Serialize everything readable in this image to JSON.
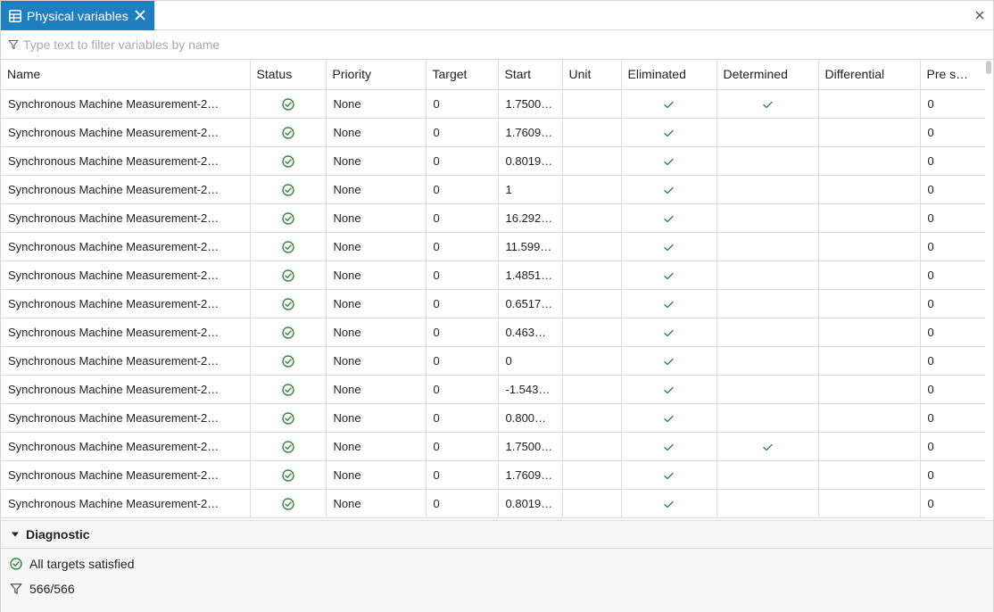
{
  "tab": {
    "label": "Physical variables",
    "icon": "table-icon"
  },
  "filter": {
    "placeholder": "Type text to filter variables by name",
    "value": ""
  },
  "columns": [
    "Name",
    "Status",
    "Priority",
    "Target",
    "Start",
    "Unit",
    "Eliminated",
    "Determined",
    "Differential",
    "Pre s…"
  ],
  "rows": [
    {
      "name": "Synchronous Machine Measurement-2…",
      "status": "ok",
      "priority": "None",
      "target": "0",
      "start": "1.7500…",
      "unit": "",
      "eliminated": true,
      "determined": true,
      "differential": false,
      "pre": "0"
    },
    {
      "name": "Synchronous Machine Measurement-2…",
      "status": "ok",
      "priority": "None",
      "target": "0",
      "start": "1.7609…",
      "unit": "",
      "eliminated": true,
      "determined": false,
      "differential": false,
      "pre": "0"
    },
    {
      "name": "Synchronous Machine Measurement-2…",
      "status": "ok",
      "priority": "None",
      "target": "0",
      "start": "0.8019…",
      "unit": "",
      "eliminated": true,
      "determined": false,
      "differential": false,
      "pre": "0"
    },
    {
      "name": "Synchronous Machine Measurement-2…",
      "status": "ok",
      "priority": "None",
      "target": "0",
      "start": "1",
      "unit": "",
      "eliminated": true,
      "determined": false,
      "differential": false,
      "pre": "0"
    },
    {
      "name": "Synchronous Machine Measurement-2…",
      "status": "ok",
      "priority": "None",
      "target": "0",
      "start": "16.292…",
      "unit": "",
      "eliminated": true,
      "determined": false,
      "differential": false,
      "pre": "0"
    },
    {
      "name": "Synchronous Machine Measurement-2…",
      "status": "ok",
      "priority": "None",
      "target": "0",
      "start": "11.599…",
      "unit": "",
      "eliminated": true,
      "determined": false,
      "differential": false,
      "pre": "0"
    },
    {
      "name": "Synchronous Machine Measurement-2…",
      "status": "ok",
      "priority": "None",
      "target": "0",
      "start": "1.4851…",
      "unit": "",
      "eliminated": true,
      "determined": false,
      "differential": false,
      "pre": "0"
    },
    {
      "name": "Synchronous Machine Measurement-2…",
      "status": "ok",
      "priority": "None",
      "target": "0",
      "start": "0.6517…",
      "unit": "",
      "eliminated": true,
      "determined": false,
      "differential": false,
      "pre": "0"
    },
    {
      "name": "Synchronous Machine Measurement-2…",
      "status": "ok",
      "priority": "None",
      "target": "0",
      "start": "0.463…",
      "unit": "",
      "eliminated": true,
      "determined": false,
      "differential": false,
      "pre": "0"
    },
    {
      "name": "Synchronous Machine Measurement-2…",
      "status": "ok",
      "priority": "None",
      "target": "0",
      "start": "0",
      "unit": "",
      "eliminated": true,
      "determined": false,
      "differential": false,
      "pre": "0"
    },
    {
      "name": "Synchronous Machine Measurement-2…",
      "status": "ok",
      "priority": "None",
      "target": "0",
      "start": "-1.543…",
      "unit": "",
      "eliminated": true,
      "determined": false,
      "differential": false,
      "pre": "0"
    },
    {
      "name": "Synchronous Machine Measurement-2…",
      "status": "ok",
      "priority": "None",
      "target": "0",
      "start": "0.800…",
      "unit": "",
      "eliminated": true,
      "determined": false,
      "differential": false,
      "pre": "0"
    },
    {
      "name": "Synchronous Machine Measurement-2…",
      "status": "ok",
      "priority": "None",
      "target": "0",
      "start": "1.7500…",
      "unit": "",
      "eliminated": true,
      "determined": true,
      "differential": false,
      "pre": "0"
    },
    {
      "name": "Synchronous Machine Measurement-2…",
      "status": "ok",
      "priority": "None",
      "target": "0",
      "start": "1.7609…",
      "unit": "",
      "eliminated": true,
      "determined": false,
      "differential": false,
      "pre": "0"
    },
    {
      "name": "Synchronous Machine Measurement-2…",
      "status": "ok",
      "priority": "None",
      "target": "0",
      "start": "0.8019…",
      "unit": "",
      "eliminated": true,
      "determined": false,
      "differential": false,
      "pre": "0"
    }
  ],
  "diagnostic": {
    "title": "Diagnostic",
    "status_text": "All targets satisfied",
    "filter_count": "566/566"
  },
  "colors": {
    "accent": "#1f7fc0",
    "success": "#2e8b3a"
  }
}
